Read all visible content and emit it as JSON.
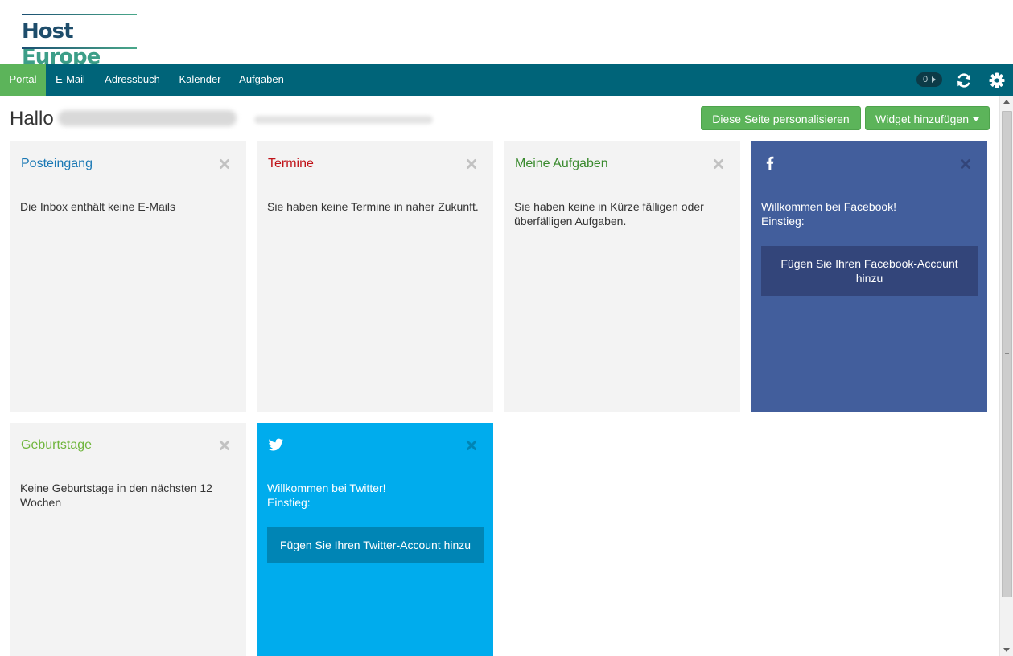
{
  "logo": {
    "part1": "Host",
    "part2": "Europe"
  },
  "nav": {
    "items": [
      {
        "label": "Portal",
        "active": true
      },
      {
        "label": "E-Mail"
      },
      {
        "label": "Adressbuch"
      },
      {
        "label": "Kalender"
      },
      {
        "label": "Aufgaben"
      }
    ],
    "notification_count": "0",
    "icons": [
      "refresh-icon",
      "gear-icon"
    ]
  },
  "greeting": {
    "hello": "Hallo"
  },
  "actions": {
    "personalize_label": "Diese Seite personalisieren",
    "add_widget_label": "Widget hinzufügen"
  },
  "colors": {
    "brand_teal": "#006479",
    "accent_green": "#5cb45a",
    "facebook_blue": "#425e9c",
    "twitter_blue": "#00aced",
    "title_inbox": "#1a78b4",
    "title_termine": "#c0141a",
    "title_aufgaben": "#3a8a2e",
    "title_geburtstage": "#6fb53c"
  },
  "widgets": {
    "posteingang": {
      "title": "Posteingang",
      "body": "Die Inbox enthält keine E-Mails"
    },
    "termine": {
      "title": "Termine",
      "body": "Sie haben keine Termine in naher Zukunft."
    },
    "aufgaben": {
      "title": "Meine Aufgaben",
      "body": "Sie haben keine in Kürze fälligen oder überfälligen Aufgaben."
    },
    "facebook": {
      "icon": "facebook-icon",
      "welcome": "Willkommen bei Facebook!",
      "einstieg": "Einstieg:",
      "button": "Fügen Sie Ihren Facebook-Account hinzu"
    },
    "geburtstage": {
      "title": "Geburtstage",
      "body": "Keine Geburtstage in den nächsten 12 Wochen"
    },
    "twitter": {
      "icon": "twitter-icon",
      "welcome": "Willkommen bei Twitter!",
      "einstieg": "Einstieg:",
      "button": "Fügen Sie Ihren Twitter-Account hinzu"
    }
  }
}
